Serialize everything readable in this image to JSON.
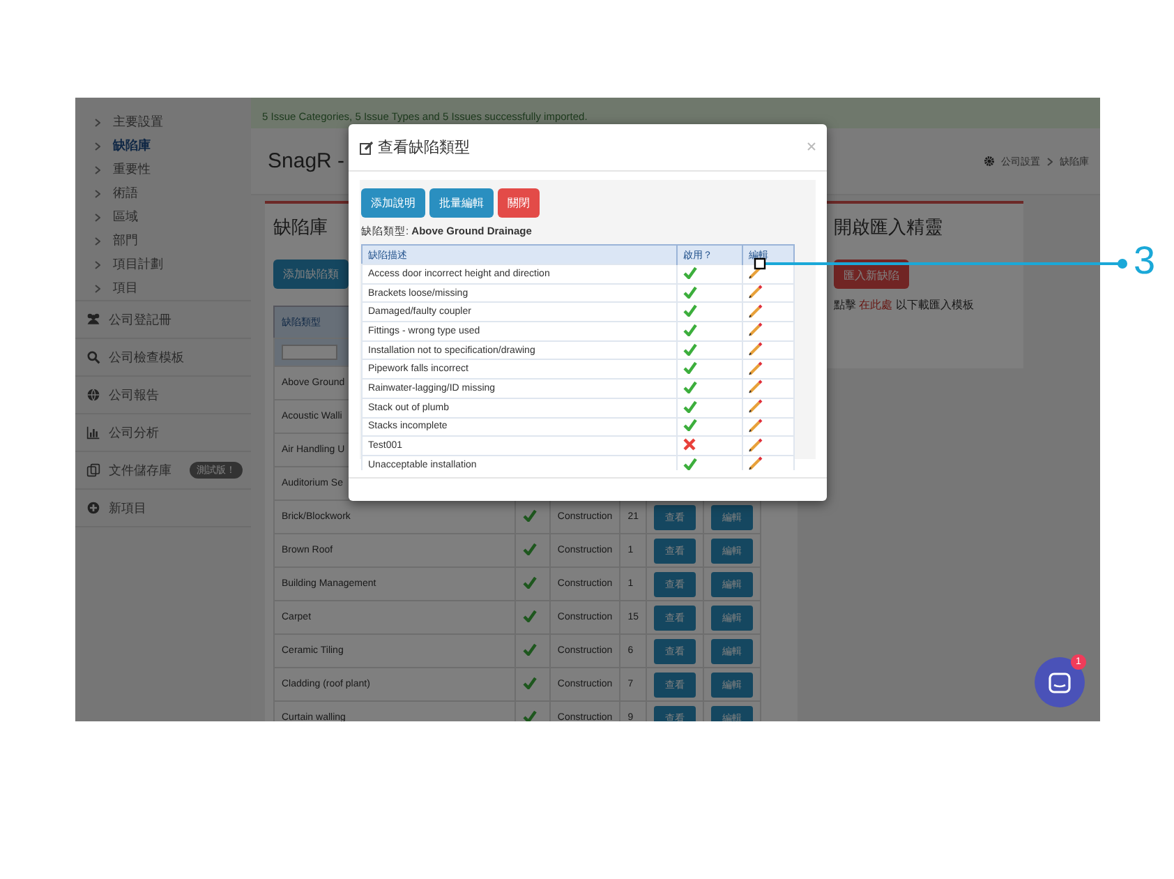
{
  "banner": {
    "text": "5 Issue Categories, 5 Issue Types and 5 Issues successfully imported."
  },
  "sidebar": {
    "submenu": [
      {
        "label": "主要設置",
        "selected": false
      },
      {
        "label": "缺陷庫",
        "selected": true
      },
      {
        "label": "重要性",
        "selected": false
      },
      {
        "label": "術語",
        "selected": false
      },
      {
        "label": "區域",
        "selected": false
      },
      {
        "label": "部門",
        "selected": false
      },
      {
        "label": "項目計劃",
        "selected": false
      },
      {
        "label": "項目",
        "selected": false
      }
    ],
    "menu": [
      {
        "label": "公司登記冊"
      },
      {
        "label": "公司檢查模板"
      },
      {
        "label": "公司報告"
      },
      {
        "label": "公司分析"
      },
      {
        "label": "文件儲存庫",
        "badge": "測試版！"
      },
      {
        "label": "新項目"
      }
    ]
  },
  "page": {
    "title": "SnagR -",
    "breadcrumb": [
      "公司設置",
      "缺陷庫"
    ]
  },
  "library_panel": {
    "title": "缺陷庫",
    "add_button": "添加缺陷類",
    "columns": [
      "缺陷類型"
    ],
    "rows": [
      {
        "name": "Above Ground"
      },
      {
        "name": "Acoustic Walli"
      },
      {
        "name": "Air Handling U"
      },
      {
        "name": "Auditorium Se"
      },
      {
        "name": "Brick/Blockwork",
        "enabled": true,
        "category": "Construction",
        "count": "21",
        "view": "查看",
        "edit": "編輯"
      },
      {
        "name": "Brown Roof",
        "enabled": true,
        "category": "Construction",
        "count": "1",
        "view": "查看",
        "edit": "編輯"
      },
      {
        "name": "Building Management",
        "enabled": true,
        "category": "Construction",
        "count": "1",
        "view": "查看",
        "edit": "編輯"
      },
      {
        "name": "Carpet",
        "enabled": true,
        "category": "Construction",
        "count": "15",
        "view": "查看",
        "edit": "編輯"
      },
      {
        "name": "Ceramic Tiling",
        "enabled": true,
        "category": "Construction",
        "count": "6",
        "view": "查看",
        "edit": "編輯"
      },
      {
        "name": "Cladding (roof plant)",
        "enabled": true,
        "category": "Construction",
        "count": "7",
        "view": "查看",
        "edit": "編輯"
      },
      {
        "name": "Curtain walling",
        "enabled": true,
        "category": "Construction",
        "count": "9",
        "view": "查看",
        "edit": "編輯"
      }
    ]
  },
  "import_panel": {
    "title": "開啟匯入精靈",
    "button": "匯入新缺陷",
    "hint_before": "點擊",
    "link": "在此處",
    "hint_after": "以下載匯入模板"
  },
  "modal": {
    "title": "查看缺陷類型",
    "buttons": [
      {
        "label": "添加說明",
        "kind": "primary"
      },
      {
        "label": "批量編輯",
        "kind": "primary"
      },
      {
        "label": "關閉",
        "kind": "danger"
      }
    ],
    "type_line": "缺陷類型: **Above Ground Drainage**",
    "columns": [
      "缺陷描述",
      "啟用？",
      "編輯"
    ],
    "rows": [
      {
        "description": "Access door incorrect height and direction",
        "enabled": true
      },
      {
        "description": "Brackets loose/missing",
        "enabled": true
      },
      {
        "description": "Damaged/faulty coupler",
        "enabled": true
      },
      {
        "description": "Fittings - wrong type used",
        "enabled": true
      },
      {
        "description": "Installation not to specification/drawing",
        "enabled": true
      },
      {
        "description": "Pipework falls incorrect",
        "enabled": true
      },
      {
        "description": "Rainwater-lagging/ID missing",
        "enabled": true
      },
      {
        "description": "Stack out of plumb",
        "enabled": true
      },
      {
        "description": "Stacks incomplete",
        "enabled": true
      },
      {
        "description": "Test001",
        "enabled": false
      },
      {
        "description": "Unacceptable installation",
        "enabled": true
      }
    ]
  },
  "chat": {
    "badge": "1"
  },
  "annotation": {
    "label": "3"
  }
}
